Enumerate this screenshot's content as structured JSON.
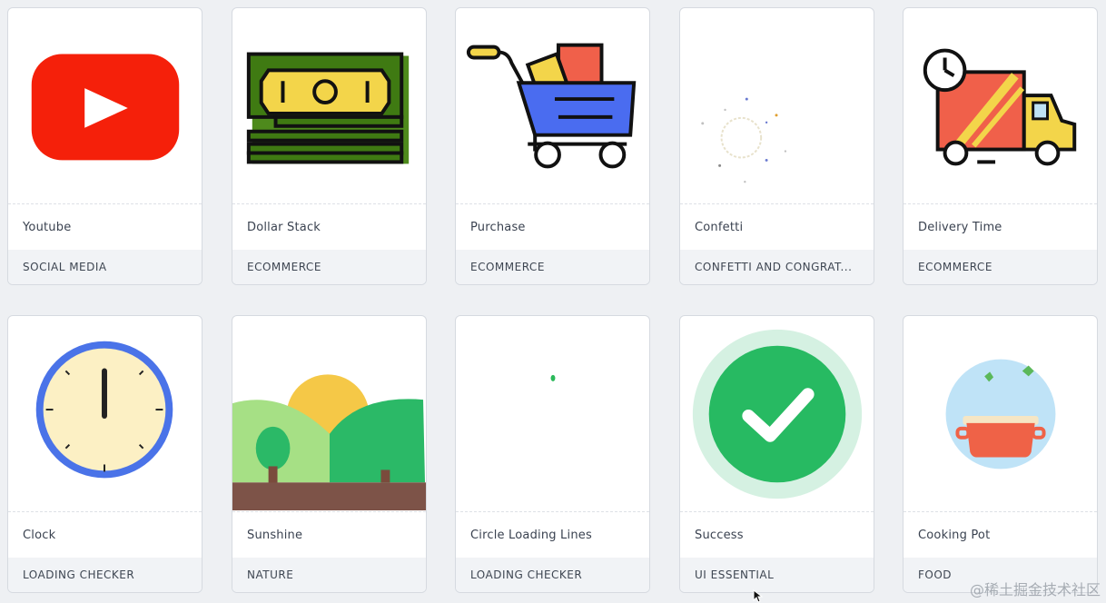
{
  "cards": [
    {
      "title": "Youtube",
      "category": "SOCIAL MEDIA",
      "icon": "youtube-icon"
    },
    {
      "title": "Dollar Stack",
      "category": "ECOMMERCE",
      "icon": "dollar-stack-icon"
    },
    {
      "title": "Purchase",
      "category": "ECOMMERCE",
      "icon": "shopping-cart-icon"
    },
    {
      "title": "Confetti",
      "category": "CONFETTI AND CONGRAT...",
      "icon": "confetti-icon"
    },
    {
      "title": "Delivery Time",
      "category": "ECOMMERCE",
      "icon": "delivery-truck-icon"
    },
    {
      "title": "Clock",
      "category": "LOADING CHECKER",
      "icon": "clock-icon"
    },
    {
      "title": "Sunshine",
      "category": "NATURE",
      "icon": "sunshine-landscape-icon"
    },
    {
      "title": "Circle Loading Lines",
      "category": "LOADING CHECKER",
      "icon": "loading-dot-icon"
    },
    {
      "title": "Success",
      "category": "UI ESSENTIAL",
      "icon": "success-check-icon"
    },
    {
      "title": "Cooking Pot",
      "category": "FOOD",
      "icon": "cooking-pot-icon"
    }
  ],
  "colors": {
    "youtube_red": "#f5200a",
    "cart_blue": "#4a6cf0",
    "success_green": "#27ba62",
    "clock_blue": "#4a73e8"
  },
  "watermark": "@稀土掘金技术社区"
}
